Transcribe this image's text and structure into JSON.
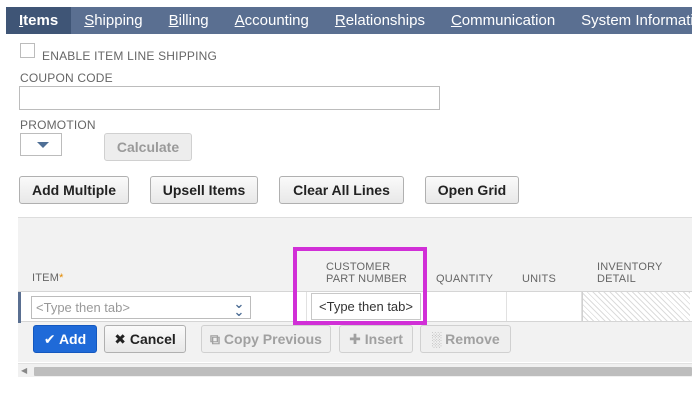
{
  "tabs": [
    {
      "first": "I",
      "rest": "tems"
    },
    {
      "first": "S",
      "rest": "hipping"
    },
    {
      "first": "B",
      "rest": "illing"
    },
    {
      "first": "A",
      "rest": "ccounting"
    },
    {
      "first": "R",
      "rest": "elationships"
    },
    {
      "first": "C",
      "rest": "ommunication"
    },
    {
      "first": "",
      "rest": "System Information"
    }
  ],
  "form": {
    "enable_item_line_shipping": "ENABLE ITEM LINE SHIPPING",
    "coupon_code_label": "COUPON CODE",
    "coupon_code_value": "",
    "promotion_label": "PROMOTION",
    "calculate_label": "Calculate"
  },
  "toolbar": {
    "add_multiple": "Add Multiple",
    "upsell_items": "Upsell Items",
    "clear_all_lines": "Clear All Lines",
    "open_grid": "Open Grid"
  },
  "sublist": {
    "columns": {
      "item": "ITEM",
      "item_required_mark": "*",
      "customer_part_number_line1": "CUSTOMER",
      "customer_part_number_line2": "PART NUMBER",
      "quantity": "QUANTITY",
      "units": "UNITS",
      "inventory_detail_line1": "INVENTORY",
      "inventory_detail_line2": "DETAIL"
    },
    "row": {
      "item_placeholder": "<Type then tab>",
      "customer_part_number_value": "<Type then tab>"
    }
  },
  "actions": {
    "add": "Add",
    "cancel": "Cancel",
    "copy_previous": "Copy Previous",
    "insert": "Insert",
    "remove": "Remove"
  },
  "colors": {
    "tabbar": "#5a6f91",
    "active_tab": "#3f5576",
    "primary_button": "#1f6ad8",
    "highlight_box": "#d12fd7",
    "required_mark": "#e38a00"
  }
}
